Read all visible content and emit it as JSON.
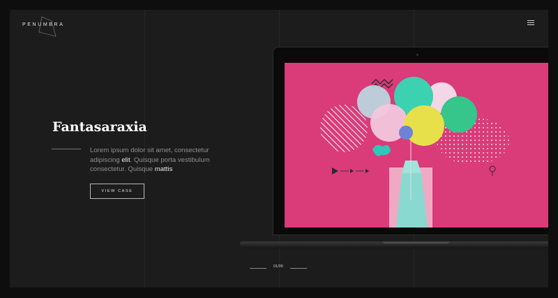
{
  "brand": {
    "name": "PENUMBRA"
  },
  "hero": {
    "title": "Fantasaraxia",
    "description": {
      "part1": "Lorem ipsum dolor sit amet, consectetur adipiscing ",
      "em1": "elit",
      "part2": ". Quisque porta vestibulum consectetur. Quisque ",
      "em2": "mattis"
    },
    "cta_label": "VIEW CASE"
  },
  "pager": {
    "text": "01/05"
  },
  "icons": {
    "logo": "diamond-outline-icon",
    "menu": "hamburger-menu-icon"
  },
  "colors": {
    "background": "#1c1c1d",
    "screen_pink": "#e0407e",
    "balloon_teal": "#3cd1b1",
    "balloon_yellow": "#e8e04a"
  }
}
